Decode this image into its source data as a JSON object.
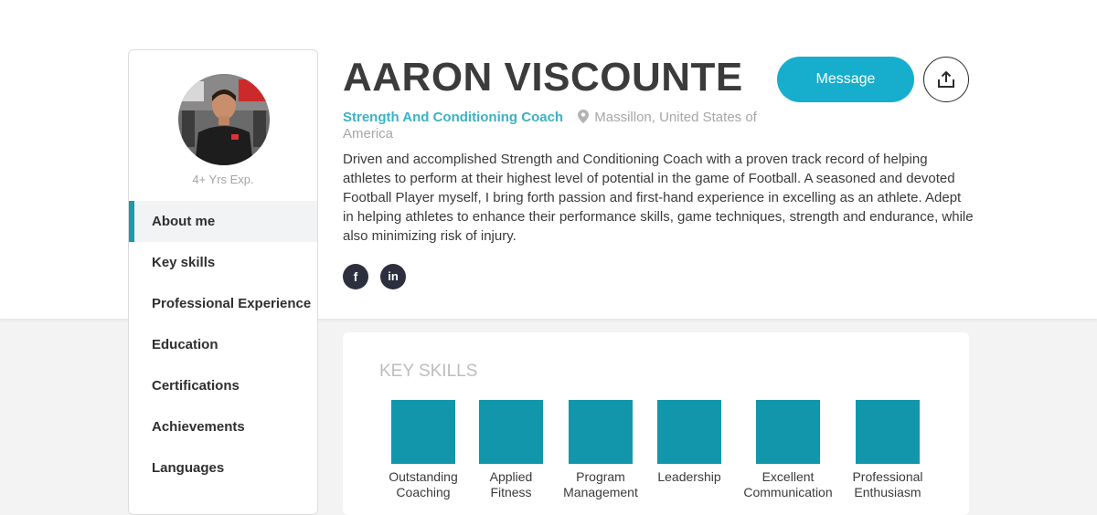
{
  "profile": {
    "name": "AARON VISCOUNTE",
    "role": "Strength And Conditioning Coach",
    "location": "Massillon, United States of America",
    "experience": "4+ Yrs Exp.",
    "bio": "Driven and accomplished Strength and Conditioning Coach with a proven track record of helping athletes to perform at their highest level of potential in the game of Football. A seasoned and devoted Football Player myself, I bring forth passion and first-hand experience in excelling as an athlete. Adept in helping athletes to enhance their performance skills, game techniques, strength and endurance, while also minimizing risk of injury."
  },
  "actions": {
    "message_label": "Message",
    "share_icon": "share-icon"
  },
  "social": {
    "facebook": "f",
    "linkedin": "in"
  },
  "sidebar": {
    "items": [
      {
        "label": "About me"
      },
      {
        "label": "Key skills"
      },
      {
        "label": "Professional Experience"
      },
      {
        "label": "Education"
      },
      {
        "label": "Certifications"
      },
      {
        "label": "Achievements"
      },
      {
        "label": "Languages"
      }
    ],
    "active": "About me"
  },
  "skills": {
    "title": "KEY SKILLS",
    "items": [
      {
        "line1": "Outstanding",
        "line2": "Coaching"
      },
      {
        "line1": "Applied",
        "line2": "Fitness"
      },
      {
        "line1": "Program",
        "line2": "Management"
      },
      {
        "line1": "Leadership",
        "line2": ""
      },
      {
        "line1": "Excellent",
        "line2": "Communication"
      },
      {
        "line1": "Professional",
        "line2": "Enthusiasm"
      }
    ]
  },
  "colors": {
    "accent": "#1a9aad",
    "button": "#17aecd",
    "role_text": "#3cb2c4",
    "skill_tile": "#1296ab",
    "social_bg": "#2c2f3d"
  }
}
